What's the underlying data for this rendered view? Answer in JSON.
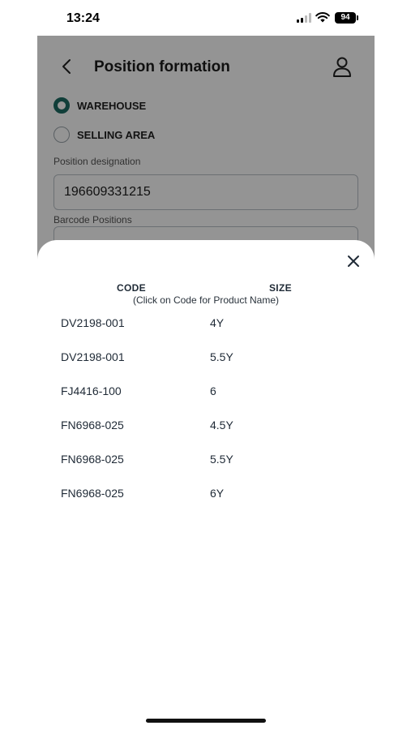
{
  "status_bar": {
    "time": "13:24",
    "battery": "94"
  },
  "screen": {
    "title": "Position formation",
    "location_options": [
      {
        "label": "WAREHOUSE",
        "selected": true
      },
      {
        "label": "SELLING AREA",
        "selected": false
      }
    ],
    "position_designation_label": "Position designation",
    "position_designation_value": "196609331215",
    "barcode_positions_label": "Barcode Positions"
  },
  "sheet": {
    "code_header": "CODE",
    "size_header": "SIZE",
    "hint": "(Click on Code for Product Name)",
    "rows": [
      {
        "code": "DV2198-001",
        "size": "4Y"
      },
      {
        "code": "DV2198-001",
        "size": "5.5Y"
      },
      {
        "code": "FJ4416-100",
        "size": "6"
      },
      {
        "code": "FN6968-025",
        "size": "4.5Y"
      },
      {
        "code": "FN6968-025",
        "size": "5.5Y"
      },
      {
        "code": "FN6968-025",
        "size": "6Y"
      }
    ]
  },
  "icons": {
    "back": "chevron-left-icon",
    "user": "user-icon",
    "close": "close-icon",
    "signal": "signal-icon",
    "wifi": "wifi-icon",
    "battery": "battery-icon"
  },
  "colors": {
    "accent": "#1c6b63",
    "overlay": "rgba(0,0,0,0.42)"
  }
}
